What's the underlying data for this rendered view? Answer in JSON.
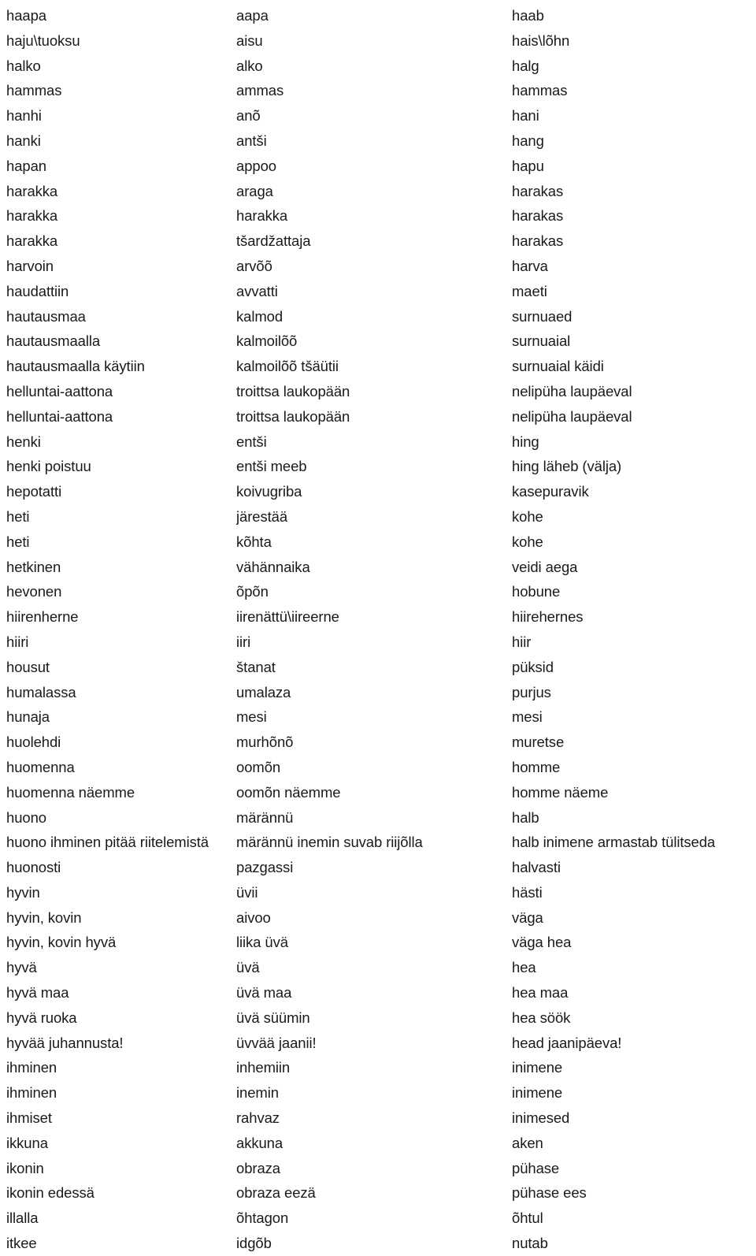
{
  "document": {
    "type": "trilingual-word-list",
    "background_color": "#ffffff",
    "text_color": "#1a1a1a",
    "columns": [
      {
        "key": "finnish",
        "index": 1
      },
      {
        "key": "votic",
        "index": 2
      },
      {
        "key": "estonian",
        "index": 3
      }
    ],
    "rows": [
      {
        "finnish": "haapa",
        "votic": "aapa",
        "estonian": "haab"
      },
      {
        "finnish": "haju\\tuoksu",
        "votic": "aisu",
        "estonian": "hais\\lõhn"
      },
      {
        "finnish": "halko",
        "votic": "alko",
        "estonian": "halg"
      },
      {
        "finnish": "hammas",
        "votic": "ammas",
        "estonian": "hammas"
      },
      {
        "finnish": "hanhi",
        "votic": "anõ",
        "estonian": "hani"
      },
      {
        "finnish": "hanki",
        "votic": "antši",
        "estonian": "hang"
      },
      {
        "finnish": "hapan",
        "votic": "appoo",
        "estonian": "hapu"
      },
      {
        "finnish": "harakka",
        "votic": "araga",
        "estonian": "harakas"
      },
      {
        "finnish": "harakka",
        "votic": "harakka",
        "estonian": "harakas"
      },
      {
        "finnish": "harakka",
        "votic": "tšardžattaja",
        "estonian": "harakas"
      },
      {
        "finnish": "harvoin",
        "votic": "arvõõ",
        "estonian": "harva"
      },
      {
        "finnish": "haudattiin",
        "votic": "avvatti",
        "estonian": "maeti"
      },
      {
        "finnish": "hautausmaa",
        "votic": "kalmod",
        "estonian": "surnuaed"
      },
      {
        "finnish": "hautausmaalla",
        "votic": "kalmoilõõ",
        "estonian": "surnuaial"
      },
      {
        "finnish": "hautausmaalla käytiin",
        "votic": "kalmoilõõ tšäütii",
        "estonian": "surnuaial käidi"
      },
      {
        "finnish": "helluntai-aattona",
        "votic": "troittsa laukopään",
        "estonian": "nelipüha laupäeval"
      },
      {
        "finnish": "helluntai-aattona",
        "votic": "troittsa laukopään",
        "estonian": "nelipüha laupäeval"
      },
      {
        "finnish": "henki",
        "votic": "entši",
        "estonian": "hing"
      },
      {
        "finnish": "henki poistuu",
        "votic": "entši meeb",
        "estonian": "hing läheb (välja)"
      },
      {
        "finnish": "hepotatti",
        "votic": "koivugriba",
        "estonian": "kasepuravik"
      },
      {
        "finnish": "heti",
        "votic": "järestää",
        "estonian": "kohe"
      },
      {
        "finnish": "heti",
        "votic": "kõhta",
        "estonian": "kohe"
      },
      {
        "finnish": "hetkinen",
        "votic": "vähännaika",
        "estonian": "veidi aega"
      },
      {
        "finnish": "hevonen",
        "votic": "õpõn",
        "estonian": "hobune"
      },
      {
        "finnish": "hiirenherne",
        "votic": "iirenättü\\iireerne",
        "estonian": "hiirehernes"
      },
      {
        "finnish": "hiiri",
        "votic": "iiri",
        "estonian": "hiir"
      },
      {
        "finnish": "housut",
        "votic": "štanat",
        "estonian": "püksid"
      },
      {
        "finnish": "humalassa",
        "votic": "umalaza",
        "estonian": "purjus"
      },
      {
        "finnish": "hunaja",
        "votic": "mesi",
        "estonian": "mesi"
      },
      {
        "finnish": "huolehdi",
        "votic": "murhõnõ",
        "estonian": "muretse"
      },
      {
        "finnish": "huomenna",
        "votic": "oomõn",
        "estonian": "homme"
      },
      {
        "finnish": "huomenna näemme",
        "votic": "oomõn näemme",
        "estonian": "homme näeme"
      },
      {
        "finnish": "huono",
        "votic": "märännü",
        "estonian": "halb"
      },
      {
        "finnish": "huono ihminen pitää riitelemistä",
        "votic": "märännü inemin  suvab riijõlla",
        "estonian": "halb inimene armastab tülitseda",
        "overflow": true
      },
      {
        "finnish": "huonosti",
        "votic": "pazgassi",
        "estonian": "halvasti"
      },
      {
        "finnish": "hyvin",
        "votic": "üvii",
        "estonian": "hästi"
      },
      {
        "finnish": "hyvin, kovin",
        "votic": "aivoo",
        "estonian": "väga"
      },
      {
        "finnish": "hyvin, kovin hyvä",
        "votic": "liika üvä",
        "estonian": "väga hea"
      },
      {
        "finnish": "hyvä",
        "votic": "üvä",
        "estonian": "hea"
      },
      {
        "finnish": "hyvä maa",
        "votic": "üvä maa",
        "estonian": "hea maa"
      },
      {
        "finnish": "hyvä ruoka",
        "votic": "üvä süümin",
        "estonian": "hea söök"
      },
      {
        "finnish": "hyvää juhannusta!",
        "votic": "üvvää jaanii!",
        "estonian": "head jaanipäeva!"
      },
      {
        "finnish": "ihminen",
        "votic": "inhemiin",
        "estonian": "inimene"
      },
      {
        "finnish": "ihminen",
        "votic": "inemin",
        "estonian": "inimene"
      },
      {
        "finnish": "ihmiset",
        "votic": "rahvaz",
        "estonian": "inimesed"
      },
      {
        "finnish": "ikkuna",
        "votic": "akkuna",
        "estonian": "aken"
      },
      {
        "finnish": "ikonin",
        "votic": "obraza",
        "estonian": "pühase"
      },
      {
        "finnish": "ikonin edessä",
        "votic": "obraza eezä",
        "estonian": "pühase ees"
      },
      {
        "finnish": "illalla",
        "votic": "õhtagon",
        "estonian": "õhtul"
      },
      {
        "finnish": "itkee",
        "votic": "idgõb",
        "estonian": "nutab"
      }
    ]
  }
}
